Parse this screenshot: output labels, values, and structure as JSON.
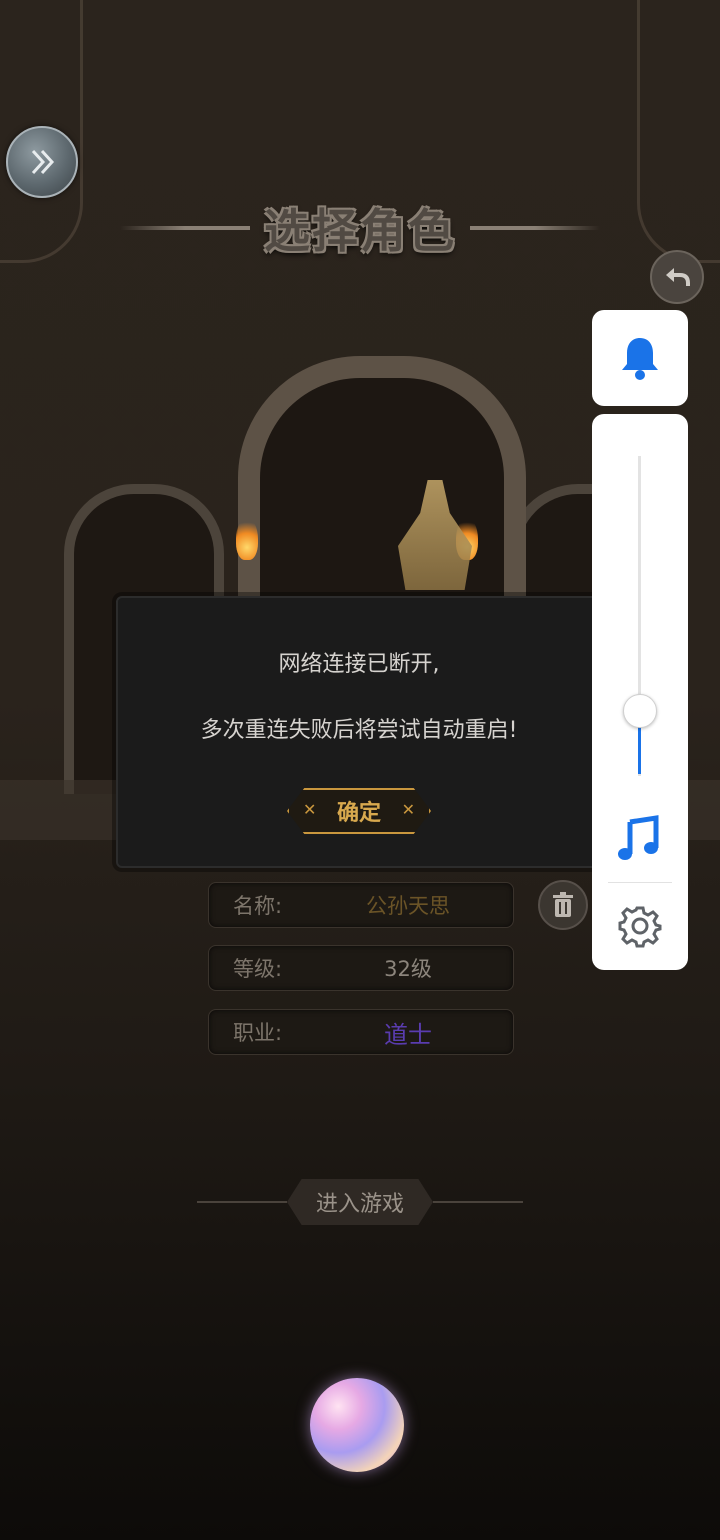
{
  "screen_title": "选择角色",
  "stats": [
    {
      "label": "名称:",
      "value": "公孙天思",
      "value_color": "#6b5427"
    },
    {
      "label": "等级:",
      "value": "32级",
      "value_color": "#8c857c"
    },
    {
      "label": "职业:",
      "value": "道士",
      "value_color": "#5a3cb0"
    }
  ],
  "enter_button_label": "进入游戏",
  "dialog": {
    "line1": "网络连接已断开,",
    "line2": "多次重连失败后将尝试自动重启!",
    "confirm_label": "确定"
  },
  "side_panel": {
    "icons": [
      "bell-icon",
      "music-note-icon",
      "gear-icon"
    ],
    "volume_level": 0.2,
    "accent_color": "#1a73e8"
  },
  "icons": {
    "expand": "double-chevron-right-icon",
    "back": "undo-arrow-icon",
    "delete": "trash-icon",
    "assistant": "siri-orb"
  }
}
